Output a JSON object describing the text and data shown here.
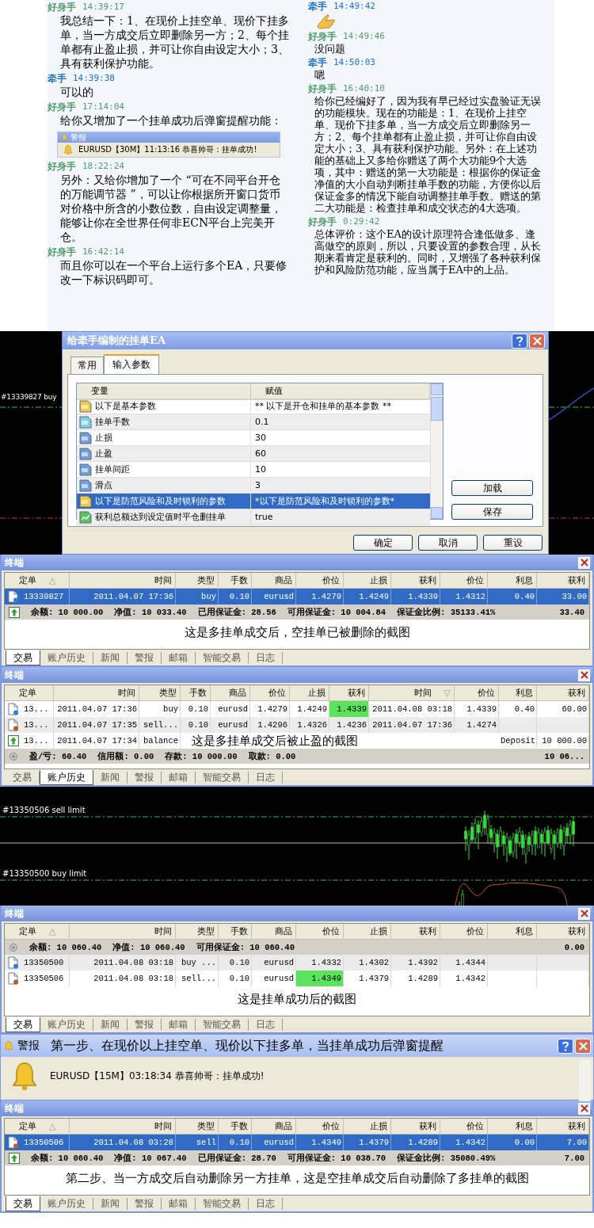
{
  "chat": {
    "columns": [
      [
        {
          "kind": "text",
          "sender": "好身手",
          "color": "#4f9c68",
          "time": "14:39:17",
          "text": "我总结一下：1、在现价上挂空单、现价下挂多单，当一方成交后立即删除另一方；2、每个挂单都有止盈止损，并可让你自由设定大小；3、具有获利保护功能。"
        },
        {
          "kind": "text",
          "sender": "牵手",
          "color": "#1f6fd1",
          "time": "14:39:38",
          "text": "可以的"
        },
        {
          "kind": "text",
          "sender": "好身手",
          "color": "#4f9c68",
          "time": "17:14:04",
          "text": "给你又增加了一个挂单成功后弹窗提醒功能：",
          "attachment": {
            "title": "警报",
            "message": "EURUSD【30M】11:13:16 恭喜帅哥：挂单成功!"
          }
        },
        {
          "kind": "text",
          "sender": "好身手",
          "color": "#4f9c68",
          "time": "18:22:24",
          "text": "另外：又给你增加了一个 “可在不同平台开仓的万能调节器 ”，可以让你根据所开窗口货币对价格中所含的小数位数，自由设定调整量，能够让你在全世界任何非ECN平台上完美开仓。"
        },
        {
          "kind": "text",
          "sender": "好身手",
          "color": "#4f9c68",
          "time": "16:42:14",
          "text": "而且你可以在一个平台上运行多个EA，只要修改一下标识码即可。"
        }
      ],
      [
        {
          "kind": "sticker",
          "sender": "牵手",
          "color": "#1f6fd1",
          "time": "14:49:42"
        },
        {
          "kind": "text",
          "sender": "好身手",
          "color": "#4f9c68",
          "time": "14:49:46",
          "text": "没问题"
        },
        {
          "kind": "text",
          "sender": "牵手",
          "color": "#1f6fd1",
          "time": "14:50:03",
          "text": "嗯"
        },
        {
          "kind": "text",
          "sender": "好身手",
          "color": "#4f9c68",
          "time": "16:40:10",
          "text": "给你已经编好了，因为我有早已经过实盘验证无误的功能模块。现在的功能是：1、在现价上挂空单、现价下挂多单，当一方成交后立即删除另一方；2、每个挂单都有止盈止损，并可让你自由设定大小；3、具有获利保护功能。另外：在上述功能的基础上又多给你赠送了两个大功能9个大选项，其中：赠送的第一大功能是：根据你的保证金净值的大小自动判断挂单手数的功能，方便你以后保证金多的情况下能自动调整挂单手数。赠送的第二大功能是：检查挂单和成交状态的4大选项。"
        },
        {
          "kind": "text",
          "sender": "好身手",
          "color": "#4f9c68",
          "time": "0:29:42",
          "text": "总体评价：这个EA的设计原理符合逢低做多、逢高做空的原则，所以，只要设置的参数合理，从长期来看肯定是获利的。同时，又增强了各种获利保护和风险防范功能，应当属于EA中的上品。"
        }
      ]
    ]
  },
  "panels": [
    {
      "kind": "dialog_scene",
      "label": "#13339827 buy",
      "dialog": {
        "title": "给牵手编制的挂单EA",
        "tabs": [
          {
            "label": "常用",
            "selected": false
          },
          {
            "label": "输入参数",
            "selected": true
          }
        ],
        "columns": [
          "变量",
          "赋值"
        ],
        "params": [
          {
            "kind": "string",
            "name": "以下是基本参数",
            "value": "** 以下是开仓和挂单的基本参数 **",
            "selected": false
          },
          {
            "kind": "double",
            "name": "挂单手数",
            "value": "0.1",
            "selected": false
          },
          {
            "kind": "int",
            "name": "止损",
            "value": "30",
            "selected": false
          },
          {
            "kind": "int",
            "name": "止盈",
            "value": "60",
            "selected": false
          },
          {
            "kind": "int",
            "name": "挂单间距",
            "value": "10",
            "selected": false
          },
          {
            "kind": "int",
            "name": "滑点",
            "value": "3",
            "selected": false
          },
          {
            "kind": "string",
            "name": "以下是防范风险和及时锁利的参数",
            "value": "*以下是防范风险和及时锁利的参数*",
            "selected": true
          },
          {
            "kind": "bool",
            "name": "获利总额达到设定值时平仓删挂单",
            "value": "true",
            "selected": false
          }
        ],
        "side_buttons": [
          "加载",
          "保存"
        ],
        "buttons": [
          "确定",
          "取消",
          "重设"
        ]
      }
    },
    {
      "kind": "terminal",
      "title": "终端",
      "columns": [
        {
          "label": "定单",
          "sort_mark": "△"
        },
        {
          "label": "时间"
        },
        {
          "label": "类型"
        },
        {
          "label": "手数"
        },
        {
          "label": "商品"
        },
        {
          "label": "价位"
        },
        {
          "label": "止损"
        },
        {
          "label": "获利"
        },
        {
          "label": "价位"
        },
        {
          "label": "利息"
        },
        {
          "label": "获利"
        }
      ],
      "body": [
        {
          "kind": "buy",
          "selected": true,
          "cells": [
            "13339827",
            "2011.04.07 17:36",
            "buy",
            "0.10",
            "eurusd",
            "1.4279",
            "1.4249",
            "1.4339",
            "1.4312",
            "0.40",
            "33.00"
          ]
        },
        {
          "kind": "summary",
          "items": [
            "余额: 10 000.00",
            "净值: 10 033.40",
            "已用保证金: 28.56",
            "可用保证金: 10 004.84",
            "保证金比例: 35133.41%"
          ],
          "total": "33.40"
        },
        {
          "kind": "caption",
          "text": "这是多挂单成交后，空挂单已被删除的截图"
        }
      ],
      "tabs": [
        {
          "label": "交易",
          "selected": true
        },
        {
          "label": "账户历史",
          "selected": false
        },
        {
          "label": "新闻",
          "selected": false
        },
        {
          "label": "警报",
          "selected": false
        },
        {
          "label": "邮箱",
          "selected": false
        },
        {
          "label": "智能交易",
          "selected": false
        },
        {
          "label": "日志",
          "selected": false
        }
      ]
    },
    {
      "kind": "terminal",
      "title": "终端",
      "columns": [
        {
          "label": "定单"
        },
        {
          "label": "时间"
        },
        {
          "label": "类型"
        },
        {
          "label": "手数"
        },
        {
          "label": "商品"
        },
        {
          "label": "价位"
        },
        {
          "label": "止损"
        },
        {
          "label": "获利"
        },
        {
          "label": "时间",
          "sort_mark": "▽"
        },
        {
          "label": "价位"
        },
        {
          "label": "利息"
        },
        {
          "label": "获利"
        }
      ],
      "body": [
        {
          "kind": "buy",
          "selected": false,
          "cells": [
            "13...",
            "2011.04.07 17:36",
            "buy",
            "0.10",
            "eurusd",
            "1.4279",
            "1.4249",
            {
              "text": "1.4339",
              "highlighted": true
            },
            "2011.04.08 03:18",
            "1.4339",
            "0.40",
            "60.00"
          ]
        },
        {
          "kind": "sell",
          "selected": false,
          "cells": [
            "13...",
            "2011.04.07 17:35",
            "sell...",
            "0.10",
            "eurusd",
            "1.4296",
            "1.4326",
            "1.4236",
            "2011.04.07 17:36",
            "1.4274"
          ]
        },
        {
          "kind": "deposit",
          "selected": false,
          "cells": [
            "13...",
            "2011.04.07 17:34",
            "balance"
          ],
          "note": "这是多挂单成交后被止盈的截图",
          "tail": [
            "Deposit",
            "10 000.00"
          ]
        },
        {
          "kind": "summary_idle",
          "items": [
            "盈/亏: 60.40",
            "信用额: 0.00",
            "存款: 10 000.00",
            "取款: 0.00"
          ],
          "total": "10 06..."
        }
      ],
      "tabs": [
        {
          "label": "交易",
          "selected": false
        },
        {
          "label": "账户历史",
          "selected": true
        },
        {
          "label": "新闻",
          "selected": false
        },
        {
          "label": "警报",
          "selected": false
        },
        {
          "label": "邮箱",
          "selected": false
        },
        {
          "label": "智能交易",
          "selected": false
        },
        {
          "label": "日志",
          "selected": false
        }
      ]
    },
    {
      "kind": "chart",
      "labels": [
        "#13350506 sell limit",
        "#13350500 buy limit"
      ]
    },
    {
      "kind": "terminal",
      "title": "终端",
      "columns": [
        {
          "label": "定单",
          "sort_mark": "△"
        },
        {
          "label": "时间"
        },
        {
          "label": "类型"
        },
        {
          "label": "手数"
        },
        {
          "label": "商品"
        },
        {
          "label": "价位"
        },
        {
          "label": "止损"
        },
        {
          "label": "获利"
        },
        {
          "label": "价位"
        },
        {
          "label": "利息"
        },
        {
          "label": "获利"
        }
      ],
      "body": [
        {
          "kind": "summary_idle",
          "items": [
            "余额: 10 060.40",
            "净值: 10 060.40",
            "可用保证金: 10 060.40"
          ],
          "total": "0.00"
        },
        {
          "kind": "buy",
          "selected": false,
          "cells": [
            "13350500",
            "2011.04.08 03:18",
            "buy ...",
            "0.10",
            "eurusd",
            "1.4332",
            "1.4302",
            "1.4392",
            "1.4344"
          ]
        },
        {
          "kind": "sell",
          "selected": false,
          "cells": [
            "13350506",
            "2011.04.08 03:18",
            "sell...",
            "0.10",
            "eurusd",
            {
              "text": "1.4349",
              "highlighted": true
            },
            "1.4379",
            "1.4289",
            "1.4342"
          ]
        },
        {
          "kind": "caption",
          "text": "这是挂单成功后的截图"
        }
      ],
      "tabs": [
        {
          "label": "交易",
          "selected": true
        },
        {
          "label": "账户历史",
          "selected": false
        },
        {
          "label": "新闻",
          "selected": false
        },
        {
          "label": "警报",
          "selected": false
        },
        {
          "label": "邮箱",
          "selected": false
        },
        {
          "label": "智能交易",
          "selected": false
        },
        {
          "label": "日志",
          "selected": false
        }
      ]
    },
    {
      "kind": "alert",
      "title": "警报",
      "caption": "第一步、在现价以上挂空单、现价以下挂多单，当挂单成功后弹窗提醒",
      "message": "EURUSD【15M】03:18:34 恭喜帅哥：挂单成功!"
    },
    {
      "kind": "terminal",
      "title": "终端",
      "columns": [
        {
          "label": "定单",
          "sort_mark": "△"
        },
        {
          "label": "时间"
        },
        {
          "label": "类型"
        },
        {
          "label": "手数"
        },
        {
          "label": "商品"
        },
        {
          "label": "价位"
        },
        {
          "label": "止损"
        },
        {
          "label": "获利"
        },
        {
          "label": "价位"
        },
        {
          "label": "利息"
        },
        {
          "label": "获利"
        }
      ],
      "body": [
        {
          "kind": "sell",
          "selected": true,
          "cells": [
            "13350506",
            "2011.04.08 03:28",
            "sell",
            "0.10",
            "eurusd",
            "1.4349",
            "1.4379",
            "1.4289",
            "1.4342",
            "0.00",
            "7.00"
          ]
        },
        {
          "kind": "summary",
          "items": [
            "余额: 10 060.40",
            "净值: 10 067.40",
            "已用保证金: 28.70",
            "可用保证金: 10 038.70",
            "保证金比例: 35080.49%"
          ],
          "total": "7.00"
        },
        {
          "kind": "caption",
          "text": "第二步、当一方成交后自动删除另一方挂单，这是空挂单成交后自动删除了多挂单的截图"
        }
      ],
      "tabs": [
        {
          "label": "交易",
          "selected": true
        },
        {
          "label": "账户历史",
          "selected": false
        },
        {
          "label": "新闻",
          "selected": false
        },
        {
          "label": "警报",
          "selected": false
        },
        {
          "label": "邮箱",
          "selected": false
        },
        {
          "label": "智能交易",
          "selected": false
        },
        {
          "label": "日志",
          "selected": false
        }
      ]
    }
  ]
}
